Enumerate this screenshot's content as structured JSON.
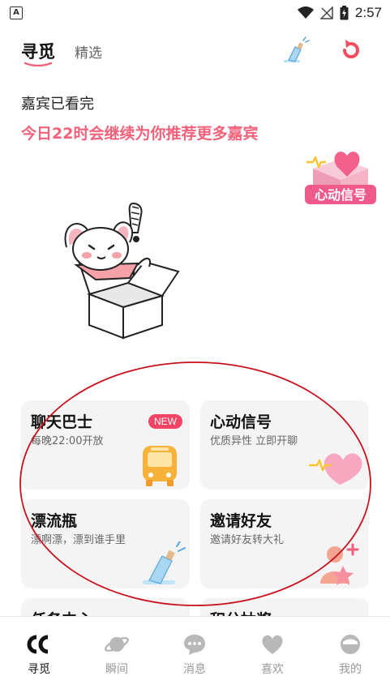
{
  "status_bar": {
    "indicator": "A",
    "time": "2:57"
  },
  "header": {
    "tab_active": "寻觅",
    "tab_secondary": "精选",
    "bottle_icon": "drift-bottle-icon",
    "refresh_icon": "refresh-icon"
  },
  "message": {
    "title": "嘉宾已看完",
    "body": "今日22时会继续为你推荐更多嘉宾"
  },
  "signal_badge": {
    "text": "心动信号"
  },
  "cards": [
    {
      "title": "聊天巴士",
      "subtitle": "每晚22:00开放",
      "badge": "NEW",
      "icon": "bus-icon"
    },
    {
      "title": "心动信号",
      "subtitle": "优质异性 立即开聊",
      "icon": "heart-icon"
    },
    {
      "title": "漂流瓶",
      "subtitle": "漂啊漂，漂到谁手里",
      "icon": "drift-bottle-icon"
    },
    {
      "title": "邀请好友",
      "subtitle": "邀请好友转大礼",
      "icon": "invite-friend-icon"
    },
    {
      "title": "任务中心",
      "subtitle": ""
    },
    {
      "title": "积分抽奖",
      "subtitle": ""
    }
  ],
  "nav": {
    "items": [
      {
        "label": "寻觅",
        "icon": "cc-logo-icon",
        "active": true
      },
      {
        "label": "瞬间",
        "icon": "planet-icon",
        "active": false
      },
      {
        "label": "消息",
        "icon": "chat-bubble-icon",
        "active": false
      },
      {
        "label": "喜欢",
        "icon": "heart-icon",
        "active": false
      },
      {
        "label": "我的",
        "icon": "profile-icon",
        "active": false
      }
    ]
  },
  "colors": {
    "accent": "#f2627a",
    "badge": "#f24463",
    "card_bg": "#f4f4f4",
    "annotation": "#c8101c"
  }
}
